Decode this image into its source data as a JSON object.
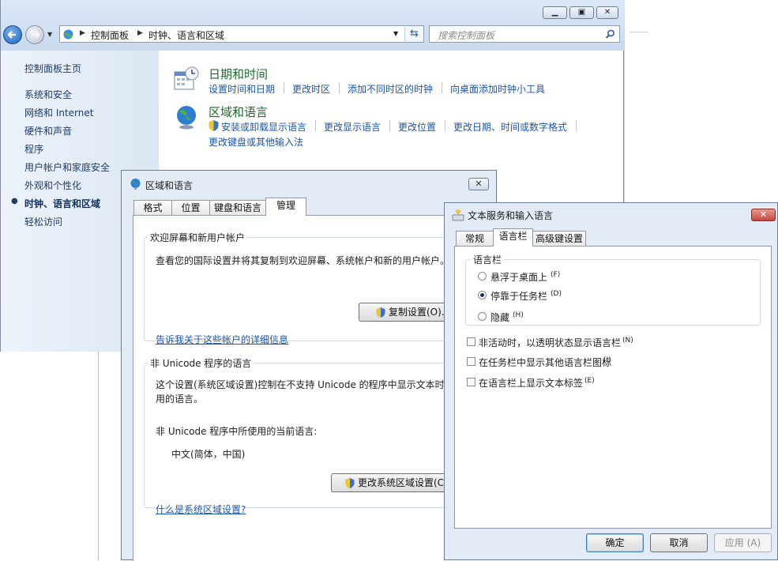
{
  "control_panel": {
    "address": {
      "crumbs": [
        "控制面板",
        "时钟、语言和区域"
      ]
    },
    "search_placeholder": "搜索控制面板",
    "sidebar": {
      "home": "控制面板主页",
      "items": [
        "系统和安全",
        "网络和 Internet",
        "硬件和声音",
        "程序",
        "用户帐户和家庭安全",
        "外观和个性化",
        "时钟、语言和区域",
        "轻松访问"
      ],
      "current_index": 6
    },
    "sections": [
      {
        "title": "日期和时间",
        "links": [
          "设置时间和日期",
          "更改时区",
          "添加不同时区的时钟",
          "向桌面添加时钟小工具"
        ]
      },
      {
        "title": "区域和语言",
        "links": [
          "安装或卸载显示语言",
          "更改显示语言",
          "更改位置",
          "更改日期、时间或数字格式",
          "更改键盘或其他输入法"
        ]
      }
    ]
  },
  "region_dialog": {
    "title": "区域和语言",
    "tabs": [
      "格式",
      "位置",
      "键盘和语言",
      "管理"
    ],
    "selected_tab": "管理",
    "welcome_group": {
      "label": "欢迎屏幕和新用户帐户",
      "text": "查看您的国际设置并将其复制到欢迎屏幕、系统帐户和新的用户帐户。",
      "button": "复制设置(O)...",
      "link": "告诉我关于这些帐户的详细信息"
    },
    "unicode_group": {
      "label": "非 Unicode 程序的语言",
      "text_line1": "这个设置(系统区域设置)控制在不支持 Unicode 的程序中显示文本时",
      "text_line2": "用的语言。",
      "current_label": "非 Unicode 程序中所使用的当前语言:",
      "current_value": "中文(简体，中国)",
      "button": "更改系统区域设置(C)...",
      "link": "什么是系统区域设置?"
    }
  },
  "text_services_dialog": {
    "title": "文本服务和输入语言",
    "tabs": [
      "常规",
      "语言栏",
      "高级键设置"
    ],
    "selected_tab": "语言栏",
    "group_label": "语言栏",
    "radios": [
      {
        "label": "悬浮于桌面上",
        "key": "(F)",
        "selected": false
      },
      {
        "label": "停靠于任务栏",
        "key": "(D)",
        "selected": true
      },
      {
        "label": "隐藏",
        "key": "(H)",
        "selected": false
      }
    ],
    "checkboxes": [
      {
        "label": "非活动时，以透明状态显示语言栏",
        "key": "(N)",
        "checked": false
      },
      {
        "label": "在任务栏中显示其他语言栏图标",
        "key": "(I)",
        "checked": false
      },
      {
        "label": "在语言栏上显示文本标签",
        "key": "(E)",
        "checked": false
      }
    ],
    "buttons": {
      "ok": "确定",
      "cancel": "取消",
      "apply": "应用 (A)"
    }
  },
  "colors": {
    "link": "#1a56b0",
    "section_title": "#1e6b2b",
    "close_red": "#c9463d"
  }
}
